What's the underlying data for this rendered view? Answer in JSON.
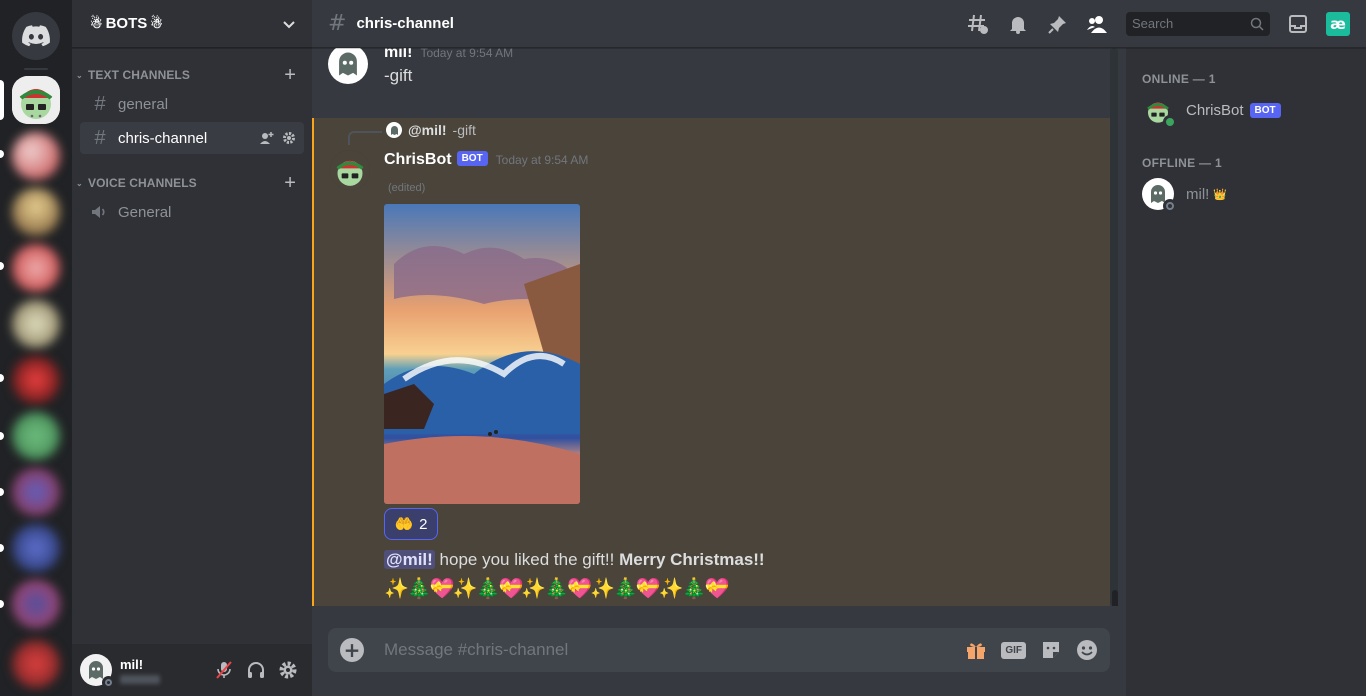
{
  "server": {
    "name": "BOTS"
  },
  "categories": {
    "text": "TEXT CHANNELS",
    "voice": "VOICE CHANNELS"
  },
  "channels": {
    "general": "general",
    "chris_channel": "chris-channel",
    "voice_general": "General"
  },
  "user": {
    "name": "mil!"
  },
  "topbar": {
    "channel": "chris-channel",
    "search_placeholder": "Search"
  },
  "messages": [
    {
      "author": "mil!",
      "time": "Today at 9:54 AM",
      "text": "-gift"
    },
    {
      "reply_author": "@mil!",
      "reply_text": "-gift",
      "author": "ChrisBot",
      "badge": "BOT",
      "time": "Today at 9:54 AM",
      "edited": "(edited)",
      "reaction_count": "2",
      "mention": "@mil!",
      "text": " hope you liked the gift!! ",
      "bold": "Merry Christmas!!",
      "emoji_line": "✨🎄💝✨🎄💝✨🎄💝✨🎄💝✨🎄💝"
    }
  ],
  "composer": {
    "placeholder": "Message #chris-channel",
    "gif_label": "GIF"
  },
  "members": {
    "online_header": "ONLINE — 1",
    "offline_header": "OFFLINE — 1",
    "online": [
      {
        "name": "ChrisBot",
        "badge": "BOT"
      }
    ],
    "offline": [
      {
        "name": "mil!",
        "crown": "👑"
      }
    ]
  },
  "colors": {
    "accent": "#5865f2",
    "mention_highlight": "#faa61a",
    "online": "#3ba55d"
  }
}
